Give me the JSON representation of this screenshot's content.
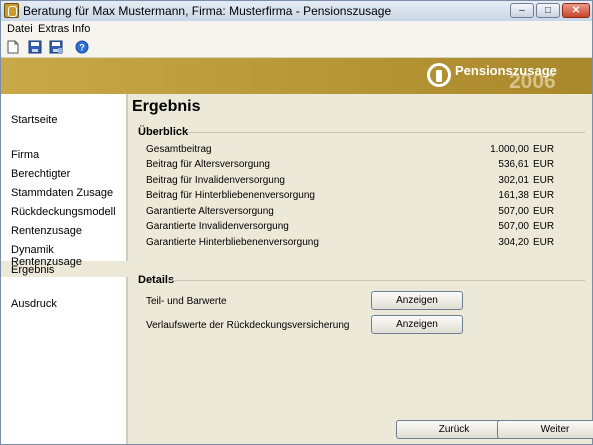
{
  "window": {
    "title": "Beratung für Max Mustermann, Firma: Musterfirma - Pensionszusage",
    "controls": {
      "minimize": "–",
      "maximize": "□",
      "close": "✕"
    }
  },
  "menu": {
    "items": [
      "Datei",
      "Extras",
      "Info"
    ]
  },
  "toolbar": {
    "icons": [
      "new-document-icon",
      "save-icon",
      "save-as-icon",
      "help-icon"
    ]
  },
  "banner": {
    "title": "Pensionszusage",
    "year": "2006",
    "colors": {
      "gold": "#b69536"
    }
  },
  "sidebar": {
    "items": [
      "Startseite",
      "Firma",
      "Berechtigter",
      "Stammdaten Zusage",
      "Rückdeckungsmodell",
      "Rentenzusage",
      "Dynamik Rentenzusage",
      "Ergebnis",
      "Ausdruck"
    ],
    "active": "Ergebnis"
  },
  "main": {
    "title": "Ergebnis",
    "overview": {
      "heading": "Überblick",
      "rows": [
        {
          "label": "Gesamtbeitrag",
          "value": "1.000,00",
          "unit": "EUR"
        },
        {
          "label": "Beitrag für Altersversorgung",
          "value": "536,61",
          "unit": "EUR"
        },
        {
          "label": "Beitrag für Invalidenversorgung",
          "value": "302,01",
          "unit": "EUR"
        },
        {
          "label": "Beitrag für Hinterbliebenenversorgung",
          "value": "161,38",
          "unit": "EUR"
        },
        {
          "label": "Garantierte Altersversorgung",
          "value": "507,00",
          "unit": "EUR"
        },
        {
          "label": "Garantierte Invalidenversorgung",
          "value": "507,00",
          "unit": "EUR"
        },
        {
          "label": "Garantierte Hinterbliebenenversorgung",
          "value": "304,20",
          "unit": "EUR"
        }
      ]
    },
    "details": {
      "heading": "Details",
      "rows": [
        {
          "label": "Teil- und Barwerte",
          "button": "Anzeigen"
        },
        {
          "label": "Verlaufswerte der Rückdeckungsversicherung",
          "button": "Anzeigen"
        }
      ]
    }
  },
  "footer": {
    "back": "Zurück",
    "next": "Weiter"
  }
}
